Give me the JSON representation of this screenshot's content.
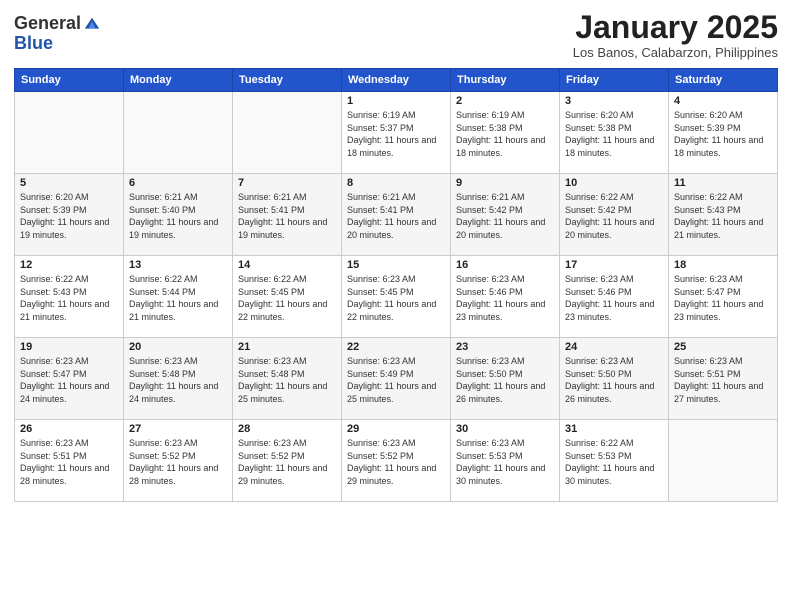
{
  "header": {
    "logo_general": "General",
    "logo_blue": "Blue",
    "month_title": "January 2025",
    "location": "Los Banos, Calabarzon, Philippines"
  },
  "weekdays": [
    "Sunday",
    "Monday",
    "Tuesday",
    "Wednesday",
    "Thursday",
    "Friday",
    "Saturday"
  ],
  "weeks": [
    [
      {
        "day": "",
        "sunrise": "",
        "sunset": "",
        "daylight": ""
      },
      {
        "day": "",
        "sunrise": "",
        "sunset": "",
        "daylight": ""
      },
      {
        "day": "",
        "sunrise": "",
        "sunset": "",
        "daylight": ""
      },
      {
        "day": "1",
        "sunrise": "Sunrise: 6:19 AM",
        "sunset": "Sunset: 5:37 PM",
        "daylight": "Daylight: 11 hours and 18 minutes."
      },
      {
        "day": "2",
        "sunrise": "Sunrise: 6:19 AM",
        "sunset": "Sunset: 5:38 PM",
        "daylight": "Daylight: 11 hours and 18 minutes."
      },
      {
        "day": "3",
        "sunrise": "Sunrise: 6:20 AM",
        "sunset": "Sunset: 5:38 PM",
        "daylight": "Daylight: 11 hours and 18 minutes."
      },
      {
        "day": "4",
        "sunrise": "Sunrise: 6:20 AM",
        "sunset": "Sunset: 5:39 PM",
        "daylight": "Daylight: 11 hours and 18 minutes."
      }
    ],
    [
      {
        "day": "5",
        "sunrise": "Sunrise: 6:20 AM",
        "sunset": "Sunset: 5:39 PM",
        "daylight": "Daylight: 11 hours and 19 minutes."
      },
      {
        "day": "6",
        "sunrise": "Sunrise: 6:21 AM",
        "sunset": "Sunset: 5:40 PM",
        "daylight": "Daylight: 11 hours and 19 minutes."
      },
      {
        "day": "7",
        "sunrise": "Sunrise: 6:21 AM",
        "sunset": "Sunset: 5:41 PM",
        "daylight": "Daylight: 11 hours and 19 minutes."
      },
      {
        "day": "8",
        "sunrise": "Sunrise: 6:21 AM",
        "sunset": "Sunset: 5:41 PM",
        "daylight": "Daylight: 11 hours and 20 minutes."
      },
      {
        "day": "9",
        "sunrise": "Sunrise: 6:21 AM",
        "sunset": "Sunset: 5:42 PM",
        "daylight": "Daylight: 11 hours and 20 minutes."
      },
      {
        "day": "10",
        "sunrise": "Sunrise: 6:22 AM",
        "sunset": "Sunset: 5:42 PM",
        "daylight": "Daylight: 11 hours and 20 minutes."
      },
      {
        "day": "11",
        "sunrise": "Sunrise: 6:22 AM",
        "sunset": "Sunset: 5:43 PM",
        "daylight": "Daylight: 11 hours and 21 minutes."
      }
    ],
    [
      {
        "day": "12",
        "sunrise": "Sunrise: 6:22 AM",
        "sunset": "Sunset: 5:43 PM",
        "daylight": "Daylight: 11 hours and 21 minutes."
      },
      {
        "day": "13",
        "sunrise": "Sunrise: 6:22 AM",
        "sunset": "Sunset: 5:44 PM",
        "daylight": "Daylight: 11 hours and 21 minutes."
      },
      {
        "day": "14",
        "sunrise": "Sunrise: 6:22 AM",
        "sunset": "Sunset: 5:45 PM",
        "daylight": "Daylight: 11 hours and 22 minutes."
      },
      {
        "day": "15",
        "sunrise": "Sunrise: 6:23 AM",
        "sunset": "Sunset: 5:45 PM",
        "daylight": "Daylight: 11 hours and 22 minutes."
      },
      {
        "day": "16",
        "sunrise": "Sunrise: 6:23 AM",
        "sunset": "Sunset: 5:46 PM",
        "daylight": "Daylight: 11 hours and 23 minutes."
      },
      {
        "day": "17",
        "sunrise": "Sunrise: 6:23 AM",
        "sunset": "Sunset: 5:46 PM",
        "daylight": "Daylight: 11 hours and 23 minutes."
      },
      {
        "day": "18",
        "sunrise": "Sunrise: 6:23 AM",
        "sunset": "Sunset: 5:47 PM",
        "daylight": "Daylight: 11 hours and 23 minutes."
      }
    ],
    [
      {
        "day": "19",
        "sunrise": "Sunrise: 6:23 AM",
        "sunset": "Sunset: 5:47 PM",
        "daylight": "Daylight: 11 hours and 24 minutes."
      },
      {
        "day": "20",
        "sunrise": "Sunrise: 6:23 AM",
        "sunset": "Sunset: 5:48 PM",
        "daylight": "Daylight: 11 hours and 24 minutes."
      },
      {
        "day": "21",
        "sunrise": "Sunrise: 6:23 AM",
        "sunset": "Sunset: 5:48 PM",
        "daylight": "Daylight: 11 hours and 25 minutes."
      },
      {
        "day": "22",
        "sunrise": "Sunrise: 6:23 AM",
        "sunset": "Sunset: 5:49 PM",
        "daylight": "Daylight: 11 hours and 25 minutes."
      },
      {
        "day": "23",
        "sunrise": "Sunrise: 6:23 AM",
        "sunset": "Sunset: 5:50 PM",
        "daylight": "Daylight: 11 hours and 26 minutes."
      },
      {
        "day": "24",
        "sunrise": "Sunrise: 6:23 AM",
        "sunset": "Sunset: 5:50 PM",
        "daylight": "Daylight: 11 hours and 26 minutes."
      },
      {
        "day": "25",
        "sunrise": "Sunrise: 6:23 AM",
        "sunset": "Sunset: 5:51 PM",
        "daylight": "Daylight: 11 hours and 27 minutes."
      }
    ],
    [
      {
        "day": "26",
        "sunrise": "Sunrise: 6:23 AM",
        "sunset": "Sunset: 5:51 PM",
        "daylight": "Daylight: 11 hours and 28 minutes."
      },
      {
        "day": "27",
        "sunrise": "Sunrise: 6:23 AM",
        "sunset": "Sunset: 5:52 PM",
        "daylight": "Daylight: 11 hours and 28 minutes."
      },
      {
        "day": "28",
        "sunrise": "Sunrise: 6:23 AM",
        "sunset": "Sunset: 5:52 PM",
        "daylight": "Daylight: 11 hours and 29 minutes."
      },
      {
        "day": "29",
        "sunrise": "Sunrise: 6:23 AM",
        "sunset": "Sunset: 5:52 PM",
        "daylight": "Daylight: 11 hours and 29 minutes."
      },
      {
        "day": "30",
        "sunrise": "Sunrise: 6:23 AM",
        "sunset": "Sunset: 5:53 PM",
        "daylight": "Daylight: 11 hours and 30 minutes."
      },
      {
        "day": "31",
        "sunrise": "Sunrise: 6:22 AM",
        "sunset": "Sunset: 5:53 PM",
        "daylight": "Daylight: 11 hours and 30 minutes."
      },
      {
        "day": "",
        "sunrise": "",
        "sunset": "",
        "daylight": ""
      }
    ]
  ]
}
